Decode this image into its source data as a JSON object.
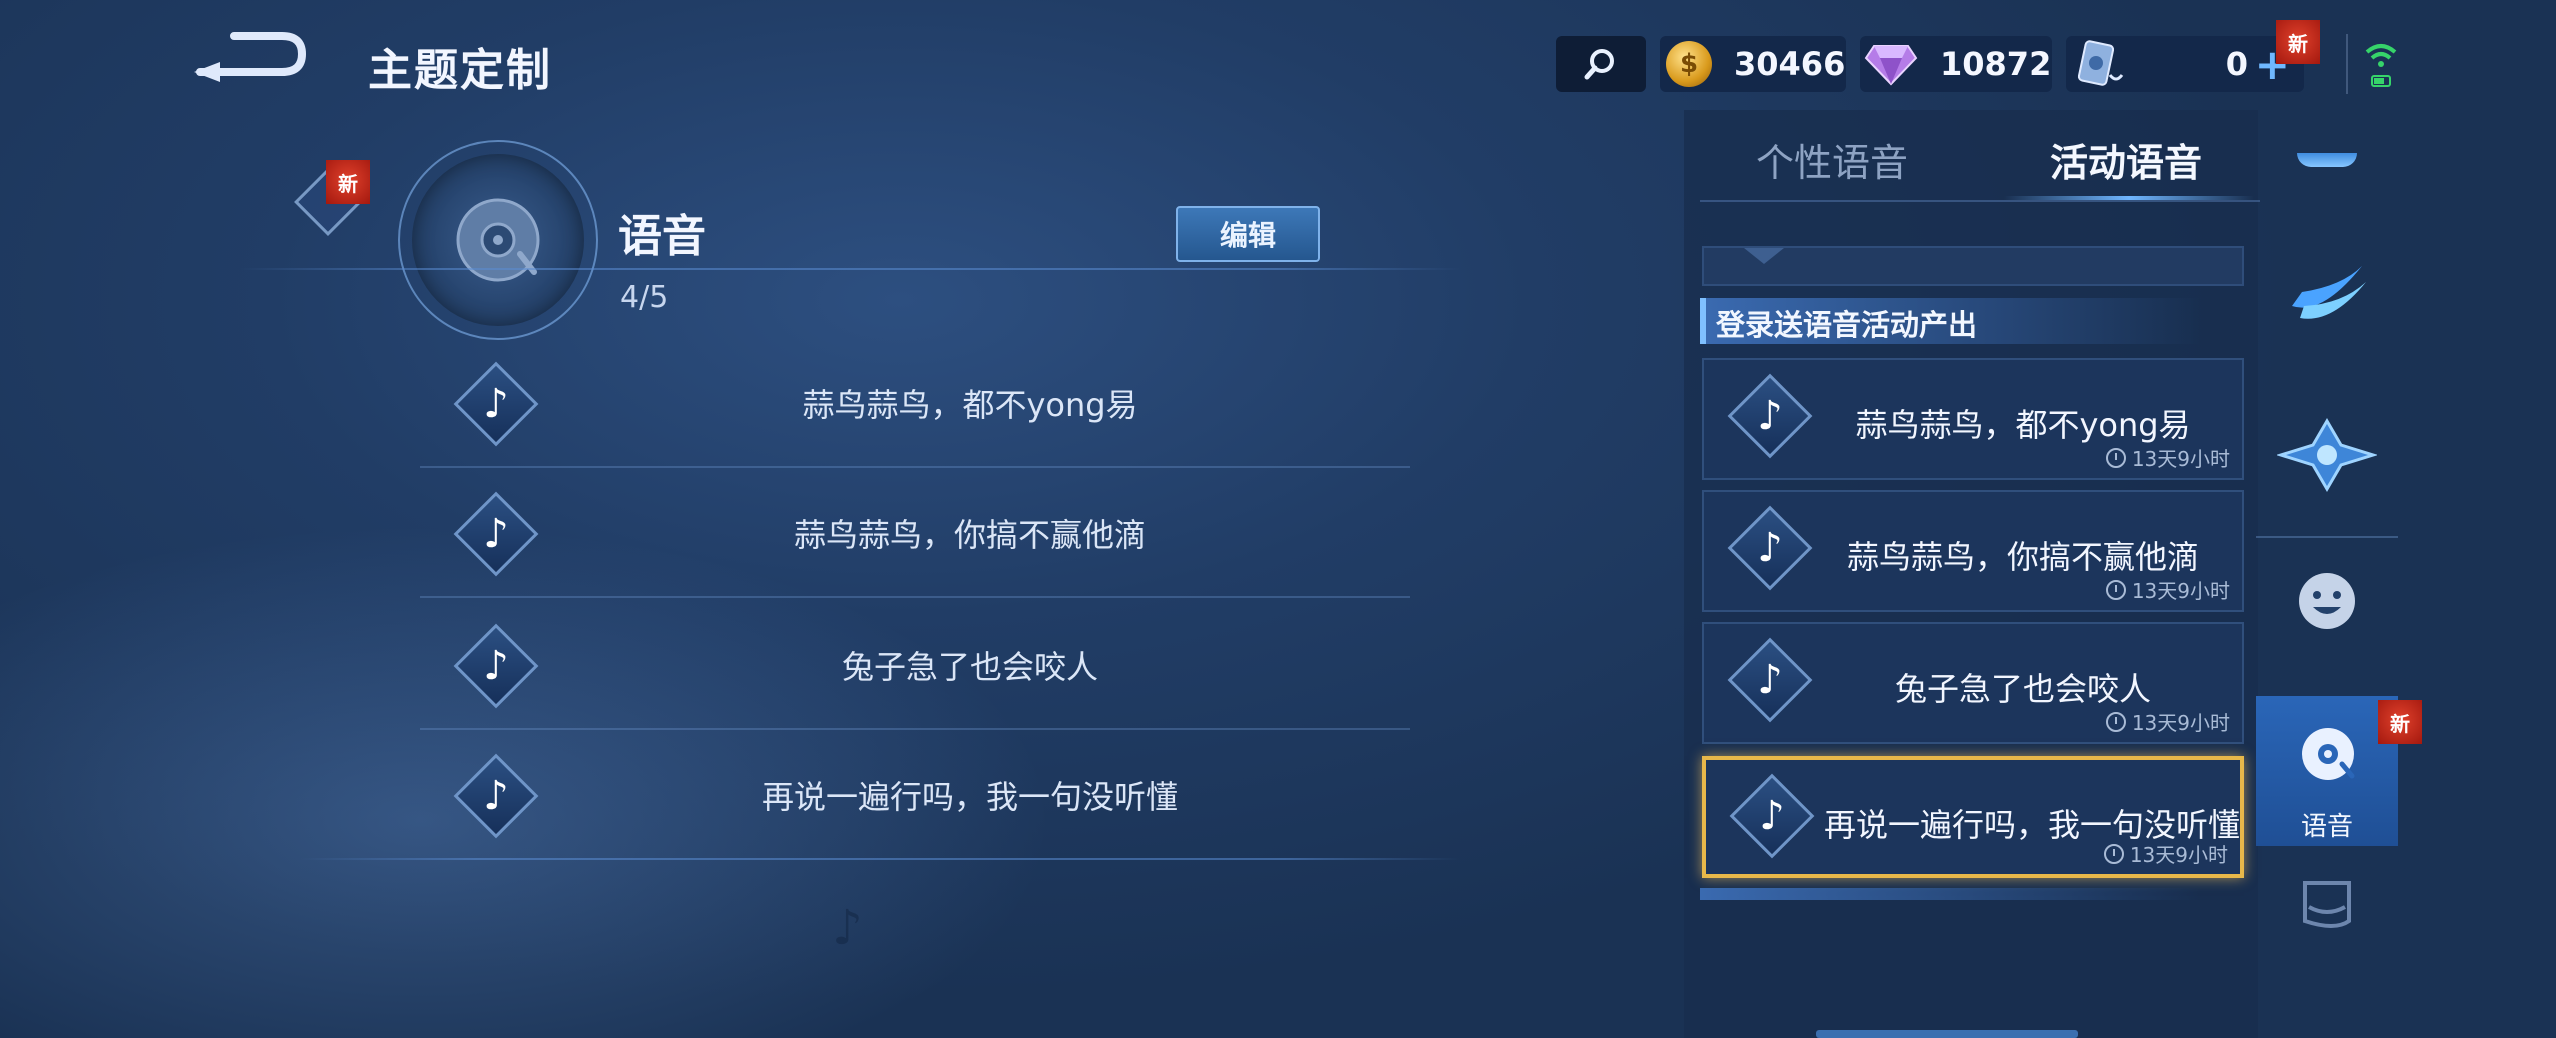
{
  "header": {
    "title": "主题定制",
    "currency": {
      "gold": "30466",
      "gems": "10872",
      "cards": "0",
      "new_badge": "新"
    }
  },
  "voice_panel": {
    "title": "语音",
    "count": "4/5",
    "edit_label": "编辑",
    "new_badge": "新",
    "equipped": [
      "蒜鸟蒜鸟，都不yong易",
      "蒜鸟蒜鸟，你搞不赢他滴",
      "兔子急了也会咬人",
      "再说一遍行吗，我一句没听懂"
    ]
  },
  "right_panel": {
    "tabs": [
      "个性语音",
      "活动语音"
    ],
    "active_tab": "活动语音",
    "group_title": "登录送语音活动产出",
    "cards": [
      {
        "text": "蒜鸟蒜鸟，都不yong易",
        "timer": "13天9小时"
      },
      {
        "text": "蒜鸟蒜鸟，你搞不赢他滴",
        "timer": "13天9小时"
      },
      {
        "text": "兔子急了也会咬人",
        "timer": "13天9小时"
      },
      {
        "text": "再说一遍行吗，我一句没听懂",
        "timer": "13天9小时"
      }
    ]
  },
  "sidebar": {
    "active_label": "语音",
    "new_badge": "新",
    "items": [
      "effect-icon",
      "frame-icon",
      "emoji-icon",
      "voice-icon",
      "card-icon"
    ]
  },
  "colors": {
    "background": "#213d66",
    "selected_border": "#e8b84a",
    "accent": "#6fb6ff"
  }
}
